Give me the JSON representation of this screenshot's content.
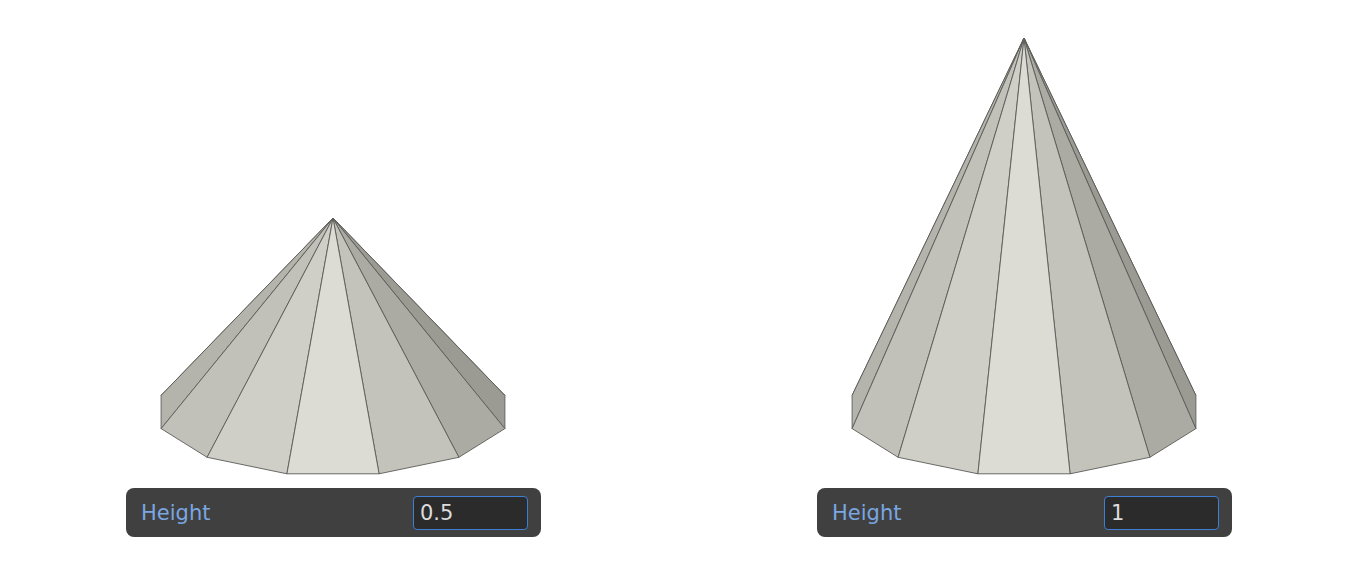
{
  "fields": [
    {
      "label": "Height",
      "value": "0.5"
    },
    {
      "label": "Height",
      "value": "1"
    }
  ]
}
